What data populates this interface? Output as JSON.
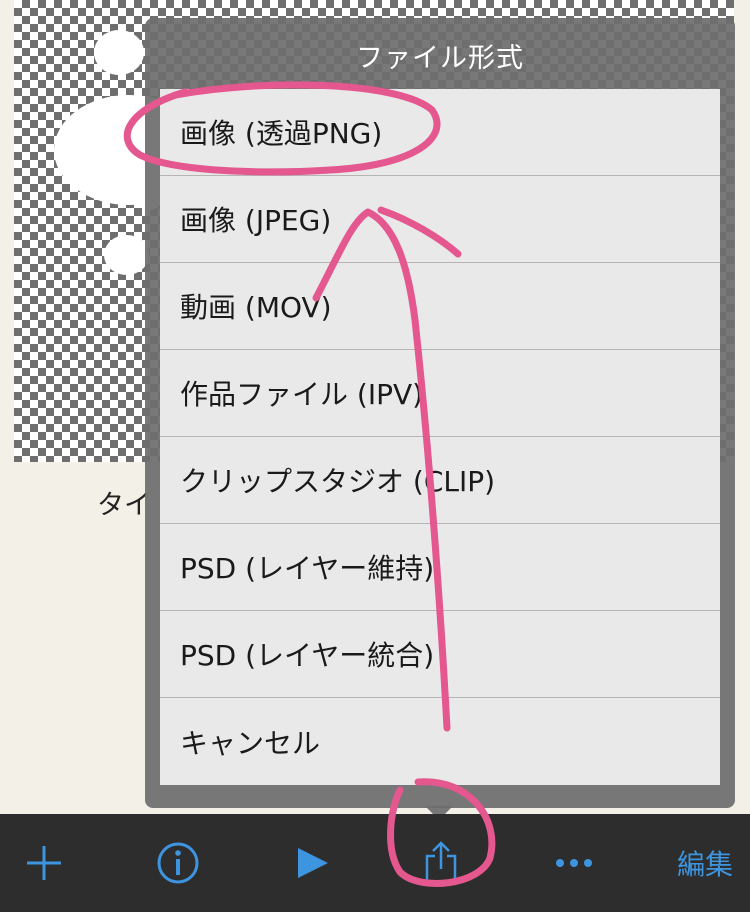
{
  "background": {
    "work_title_fragment": "タイ"
  },
  "popover": {
    "title": "ファイル形式",
    "items": [
      {
        "label": "画像 (透過PNG)"
      },
      {
        "label": "画像 (JPEG)"
      },
      {
        "label": "動画 (MOV)"
      },
      {
        "label": "作品ファイル (IPV)"
      },
      {
        "label": "クリップスタジオ (CLIP)"
      },
      {
        "label": "PSD (レイヤー維持)"
      },
      {
        "label": "PSD (レイヤー統合)"
      },
      {
        "label": "キャンセル"
      }
    ]
  },
  "toolbar": {
    "add_icon": "plus-icon",
    "info_icon": "info-icon",
    "play_icon": "play-icon",
    "share_icon": "share-icon",
    "more_icon": "more-icon",
    "edit_label": "編集"
  },
  "colors": {
    "accent": "#3d95e0",
    "annotation": "#e4578f",
    "toolbar_bg": "#2d2d2d"
  }
}
